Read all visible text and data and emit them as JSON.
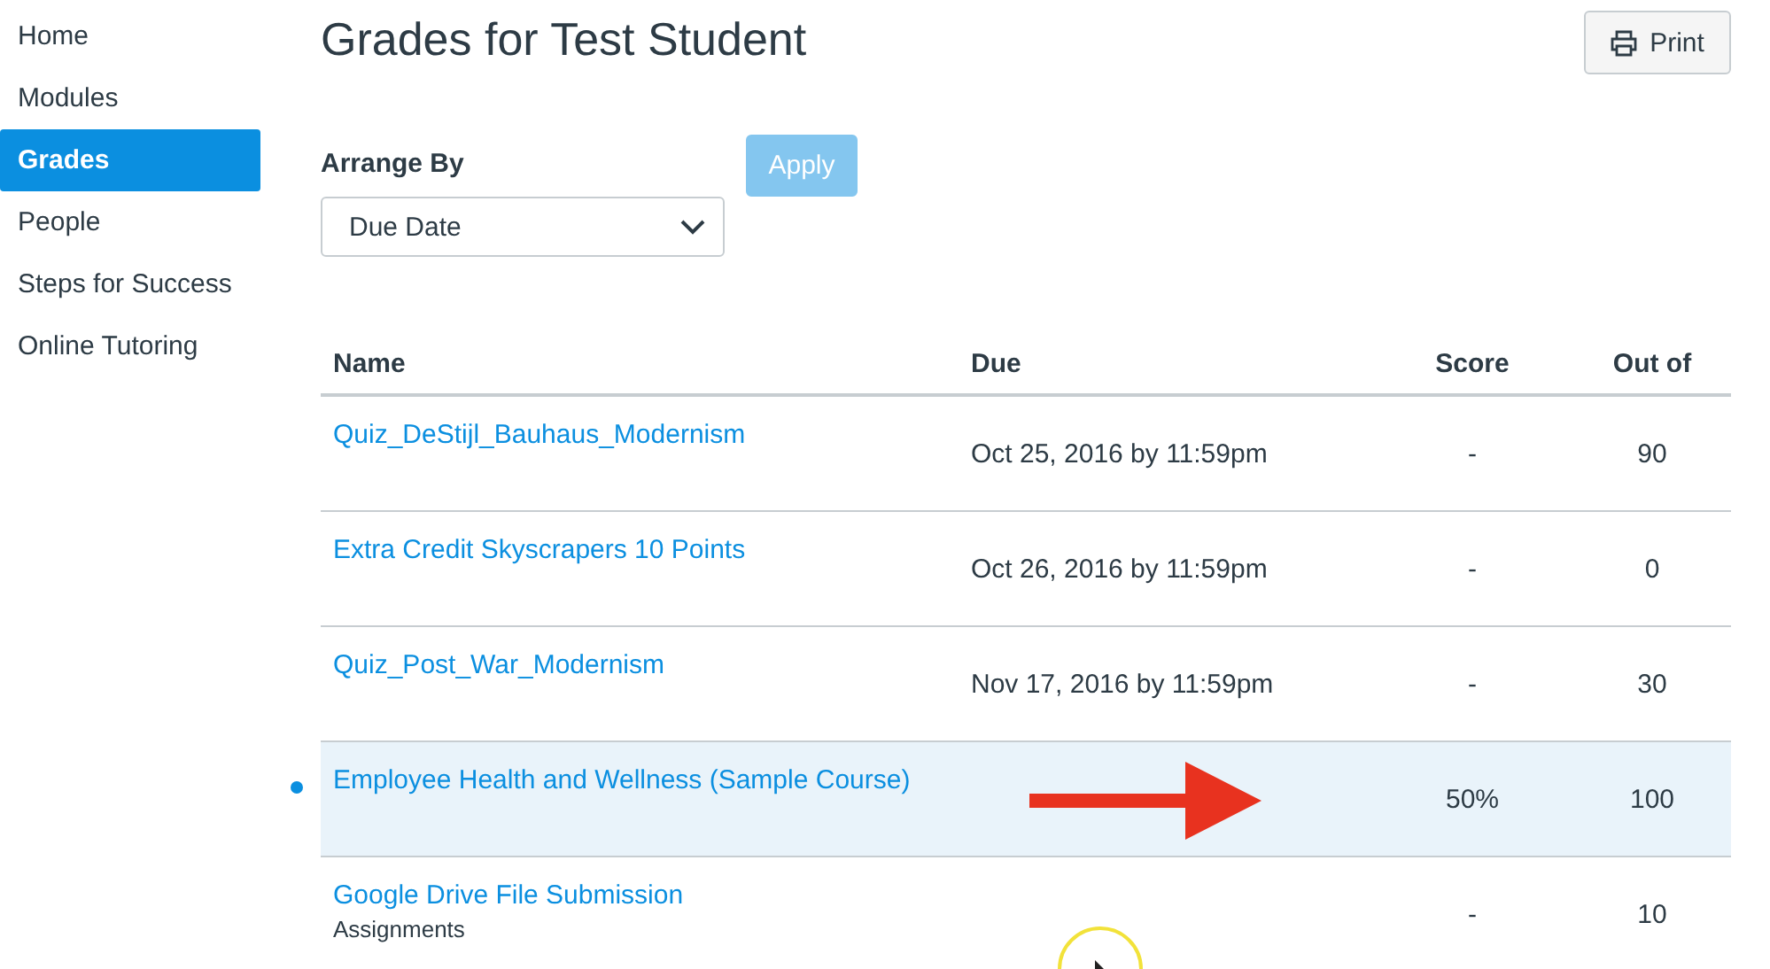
{
  "sidebar": {
    "items": [
      {
        "label": "Home",
        "selected": false
      },
      {
        "label": "Modules",
        "selected": false
      },
      {
        "label": "Grades",
        "selected": true
      },
      {
        "label": "People",
        "selected": false
      },
      {
        "label": "Steps for Success",
        "selected": false
      },
      {
        "label": "Online Tutoring",
        "selected": false
      }
    ]
  },
  "title": "Grades for Test Student",
  "print_button": "Print",
  "arrange": {
    "label": "Arrange By",
    "value": "Due Date",
    "apply": "Apply",
    "apply_disabled": true
  },
  "table": {
    "columns": [
      "Name",
      "Due",
      "Score",
      "Out of"
    ],
    "rows": [
      {
        "name": "Quiz_DeStijl_Bauhaus_Modernism",
        "due": "Oct 25, 2016 by 11:59pm",
        "score": "-",
        "out_of": "90",
        "highlighted": false,
        "unread": false
      },
      {
        "name": "Extra Credit Skyscrapers 10 Points",
        "due": "Oct 26, 2016 by 11:59pm",
        "score": "-",
        "out_of": "0",
        "highlighted": false,
        "unread": false
      },
      {
        "name": "Quiz_Post_War_Modernism",
        "due": "Nov 17, 2016 by 11:59pm",
        "score": "-",
        "out_of": "30",
        "highlighted": false,
        "unread": false
      },
      {
        "name": "Employee Health and Wellness (Sample Course)",
        "score": "50%",
        "out_of": "100",
        "highlighted": true,
        "unread": true
      },
      {
        "name": "Google Drive File Submission",
        "subtitle": "Assignments",
        "score": "-",
        "out_of": "10",
        "highlighted": false,
        "unread": false
      }
    ]
  }
}
